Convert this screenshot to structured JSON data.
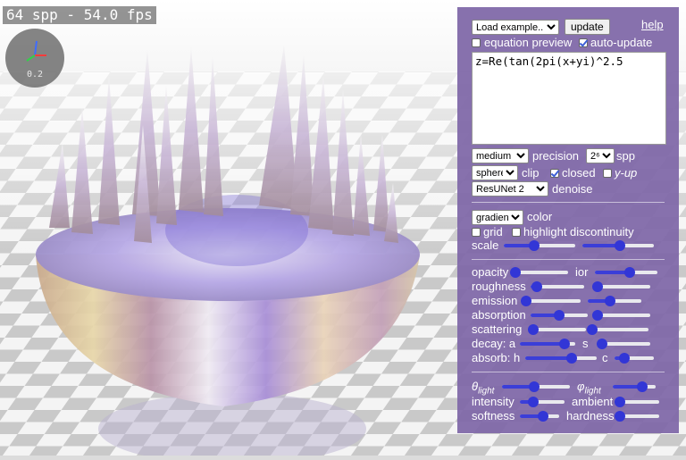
{
  "viewport": {
    "fps_text": "64 spp - 54.0 fps",
    "axis_value": "0.2"
  },
  "panel": {
    "example_select": "Load example...",
    "update_label": "update",
    "help_label": "help",
    "equation_preview_label": "equation preview",
    "equation_preview_checked": false,
    "auto_update_label": "auto-update",
    "auto_update_checked": true,
    "equation": "z=Re(tan(2pi(x+yi)^2.5",
    "precision_select": "medium",
    "precision_label": "precision",
    "spp_select": "2⁶",
    "spp_label": "spp",
    "clip_select": "sphere",
    "clip_label": "clip",
    "closed_label": "closed",
    "closed_checked": true,
    "yup_label": "y-up",
    "yup_checked": false,
    "denoise_select": "ResUNet 2",
    "denoise_label": "denoise",
    "color_select": "gradient",
    "color_label": "color",
    "grid_label": "grid",
    "grid_checked": false,
    "highlight_label": "highlight discontinuity",
    "highlight_checked": false,
    "scale_label": "scale",
    "sliders": {
      "scale_a": 0.42,
      "scale_b": 0.52,
      "opacity": 0.05,
      "ior": 0.55,
      "roughness": 0.12,
      "roughness_b": 0.08,
      "emission": 0.02,
      "emission_b": 0.42,
      "absorption": 0.5,
      "absorption_b": 0.08,
      "scattering": 0.02,
      "scattering_b": 0.02,
      "decay_a": 0.8,
      "decay_s": 0.1,
      "absorb_h": 0.65,
      "absorb_c": 0.25,
      "theta_light": 0.48,
      "phi_light": 0.68,
      "intensity": 0.3,
      "ambient": 0.05,
      "softness": 0.58,
      "hardness": 0.05
    },
    "opacity_label": "opacity",
    "ior_label": "ior",
    "roughness_label": "roughness",
    "emission_label": "emission",
    "absorption_label": "absorption",
    "scattering_label": "scattering",
    "decay_label": "decay: a",
    "decay_s_label": "s",
    "absorb_label": "absorb: h",
    "absorb_c_label": "c",
    "theta_symbol": "θ",
    "theta_sub": "light",
    "phi_symbol": "φ",
    "phi_sub": "light",
    "intensity_label": "intensity",
    "ambient_label": "ambient",
    "softness_label": "softness",
    "hardness_label": "hardness"
  },
  "colors": {
    "panel_bg": "#8068a8",
    "slider_accent": "#3236d6"
  }
}
